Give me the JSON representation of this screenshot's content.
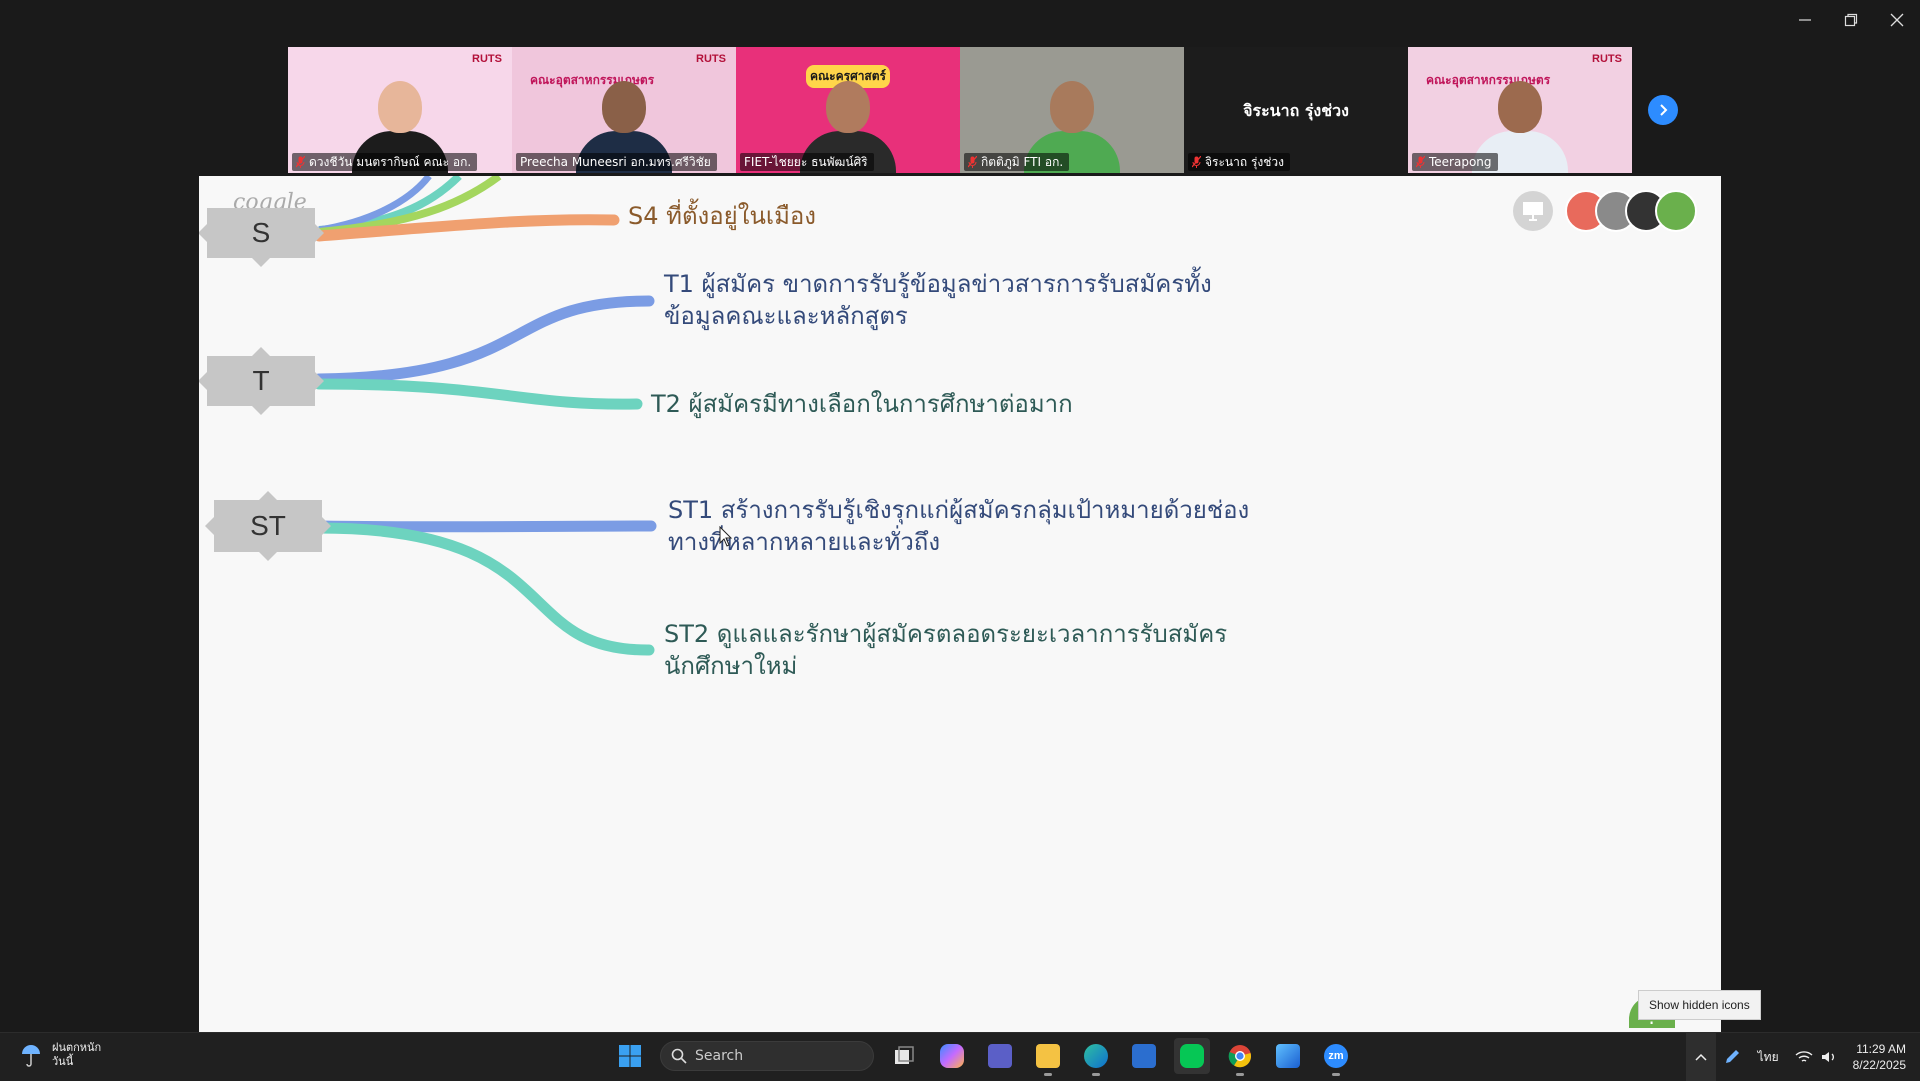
{
  "window": {
    "minimize": "minimize",
    "restore": "restore",
    "close": "close"
  },
  "participants": [
    {
      "name": "ดวงชีวัน มนตรากิษณ์ คณะ อก.",
      "muted": true,
      "brand": "RUTS",
      "banner": "",
      "bg": "#f7d7ea",
      "skin": "#e7b69a",
      "shirt": "#1c1c1c"
    },
    {
      "name": "Preecha Muneesri อก.มทร.ศรีวิชัย",
      "muted": false,
      "brand": "RUTS",
      "banner": "คณะอุตสาหกรรมเกษตร",
      "bg": "#f0c6dc",
      "skin": "#8a6048",
      "shirt": "#1e2d45"
    },
    {
      "name": "FIET-ไชยยะ ธนพัฒน์ศิริ",
      "muted": false,
      "brand": "",
      "banner": "คณะครุศาสตร์",
      "bg": "#e8307a",
      "skin": "#b07b5e",
      "shirt": "#2a2a2a",
      "active": true
    },
    {
      "name": "กิตติภูมิ FTI อก.",
      "muted": true,
      "brand": "",
      "banner": "",
      "bg": "#9a9a92",
      "skin": "#a87a5c",
      "shirt": "#4faa52"
    },
    {
      "name": "จิระนาถ รุ่งช่วง",
      "muted": true,
      "brand": "",
      "banner": "",
      "bg": "#1c1c1c",
      "camera_off": true,
      "display_name": "จิระนาถ รุ่งช่วง"
    },
    {
      "name": "Teerapong",
      "muted": true,
      "brand": "RUTS",
      "banner": "คณะอุตสาหกรรมเกษตร",
      "bg": "#f2d0e2",
      "skin": "#9c6a4e",
      "shirt": "#e8eef5"
    }
  ],
  "slide": {
    "watermark": "coggle",
    "nodes": {
      "s": "S",
      "t": "T",
      "st": "ST"
    },
    "leaves": {
      "s4": "S4 ที่ตั้งอยู่ในเมือง",
      "t1": "T1 ผู้สมัคร ขาดการรับรู้ข้อมูลข่าวสารการรับสมัครทั้ง ข้อมูลคณะและหลักสูตร",
      "t2": "T2 ผู้สมัครมีทางเลือกในการศึกษาต่อมาก",
      "st1": "ST1 สร้างการรับรู้เชิงรุกแก่ผู้สมัครกลุ่มเป้าหมายด้วยช่อง ทางที่หลากหลายและทั่วถึง",
      "st2": "ST2 ดูแลและรักษาผู้สมัครตลอดระยะเวลาการรับสมัคร นักศึกษาใหม่"
    },
    "colors": {
      "s4": "#8a5a2b",
      "t": "#344a7a",
      "st": "#2e5a56",
      "orange": "#f0a070",
      "blue": "#7b9ce4",
      "teal": "#6dd3bf"
    },
    "help": "?"
  },
  "tooltip": "Show hidden icons",
  "taskbar": {
    "weather_line1": "ฝนตกหนัก",
    "weather_line2": "วันนี้",
    "search_placeholder": "Search",
    "lang": "ไทย",
    "time": "11:29 AM",
    "date": "8/22/2025"
  }
}
